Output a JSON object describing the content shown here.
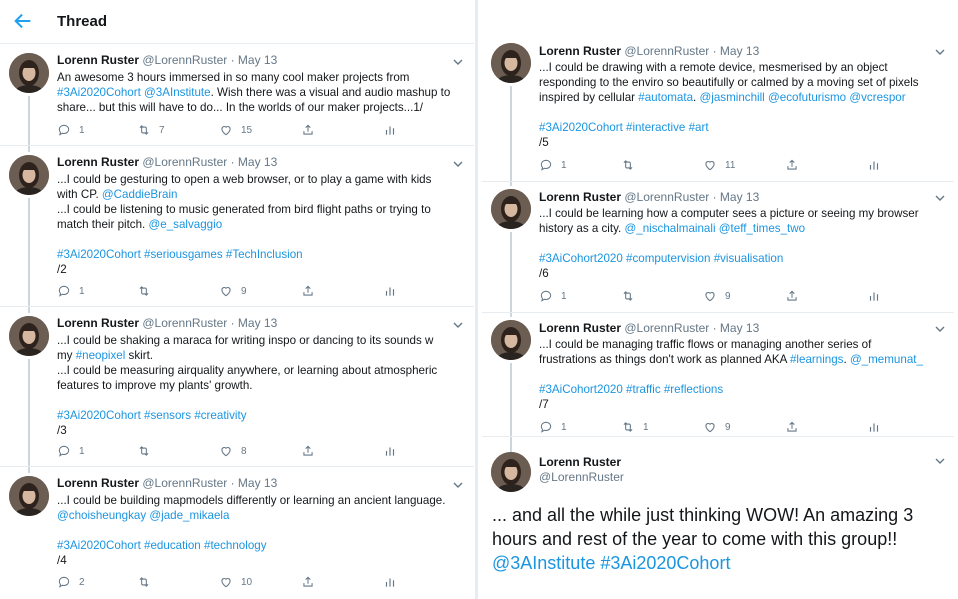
{
  "header": {
    "title": "Thread",
    "back_icon": "arrow-left-icon"
  },
  "left": [
    {
      "name": "Lorenn Ruster",
      "handle": "@LorennRuster",
      "date": "· May 13",
      "lines": [
        [
          {
            "t": "An awesome 3 hours immersed in so many cool maker projects from"
          }
        ],
        [
          {
            "t": "#3Ai2020Cohort",
            "l": true
          },
          {
            "t": " "
          },
          {
            "t": "@3AInstitute",
            "l": true
          },
          {
            "t": ". Wish there was a visual and audio mashup to"
          }
        ],
        [
          {
            "t": "share... but this will have to do... In the worlds of our maker projects...1/"
          }
        ]
      ],
      "reply": "1",
      "retweet": "7",
      "like": "15"
    },
    {
      "name": "Lorenn Ruster",
      "handle": "@LorennRuster",
      "date": "· May 13",
      "lines": [
        [
          {
            "t": "...I could be gesturing to open a web browser, or to play a game with kids"
          }
        ],
        [
          {
            "t": "with CP. "
          },
          {
            "t": "@CaddieBrain",
            "l": true
          }
        ],
        [
          {
            "t": "...I could be listening to music generated from bird flight paths or trying to"
          }
        ],
        [
          {
            "t": "match their pitch. "
          },
          {
            "t": "@e_salvaggio",
            "l": true
          }
        ],
        [
          {
            "t": ""
          }
        ],
        [
          {
            "t": "#3Ai2020Cohort",
            "l": true
          },
          {
            "t": " "
          },
          {
            "t": "#seriousgames",
            "l": true
          },
          {
            "t": " "
          },
          {
            "t": "#TechInclusion",
            "l": true
          }
        ],
        [
          {
            "t": "/2"
          }
        ]
      ],
      "reply": "1",
      "retweet": "",
      "like": "9"
    },
    {
      "name": "Lorenn Ruster",
      "handle": "@LorennRuster",
      "date": "· May 13",
      "lines": [
        [
          {
            "t": "...I could be shaking a maraca for writing inspo or dancing to its sounds w"
          }
        ],
        [
          {
            "t": "my "
          },
          {
            "t": "#neopixel",
            "l": true
          },
          {
            "t": " skirt."
          }
        ],
        [
          {
            "t": "...I could be measuring airquality anywhere, or learning about atmospheric"
          }
        ],
        [
          {
            "t": "features to improve my plants' growth."
          }
        ],
        [
          {
            "t": ""
          }
        ],
        [
          {
            "t": "#3Ai2020Cohort",
            "l": true
          },
          {
            "t": " "
          },
          {
            "t": "#sensors",
            "l": true
          },
          {
            "t": " "
          },
          {
            "t": "#creativity",
            "l": true
          }
        ],
        [
          {
            "t": "/3"
          }
        ]
      ],
      "reply": "1",
      "retweet": "",
      "like": "8"
    },
    {
      "name": "Lorenn Ruster",
      "handle": "@LorennRuster",
      "date": "· May 13",
      "lines": [
        [
          {
            "t": "...I could be building mapmodels differently or learning an ancient language."
          }
        ],
        [
          {
            "t": "@choisheungkay",
            "l": true
          },
          {
            "t": " "
          },
          {
            "t": "@jade_mikaela",
            "l": true
          }
        ],
        [
          {
            "t": ""
          }
        ],
        [
          {
            "t": "#3Ai2020Cohort",
            "l": true
          },
          {
            "t": " "
          },
          {
            "t": "#education",
            "l": true
          },
          {
            "t": " "
          },
          {
            "t": "#technology",
            "l": true
          }
        ],
        [
          {
            "t": "/4"
          }
        ]
      ],
      "reply": "2",
      "retweet": "",
      "like": "10"
    }
  ],
  "right": [
    {
      "name": "Lorenn Ruster",
      "handle": "@LorennRuster",
      "date": "· May 13",
      "lines": [
        [
          {
            "t": "...I could be drawing with a remote device, mesmerised by an object"
          }
        ],
        [
          {
            "t": "responding to the enviro so beautifully or calmed by a moving set of pixels"
          }
        ],
        [
          {
            "t": "inspired by cellular "
          },
          {
            "t": "#automata",
            "l": true
          },
          {
            "t": ". "
          },
          {
            "t": "@jasminchill",
            "l": true
          },
          {
            "t": "  "
          },
          {
            "t": "@ecofuturismo",
            "l": true
          },
          {
            "t": " "
          },
          {
            "t": "@vcrespor",
            "l": true
          }
        ],
        [
          {
            "t": ""
          }
        ],
        [
          {
            "t": "#3Ai2020Cohort",
            "l": true
          },
          {
            "t": "  "
          },
          {
            "t": "#interactive",
            "l": true
          },
          {
            "t": " "
          },
          {
            "t": "#art",
            "l": true
          }
        ],
        [
          {
            "t": "/5"
          }
        ]
      ],
      "reply": "1",
      "retweet": "",
      "like": "11"
    },
    {
      "name": "Lorenn Ruster",
      "handle": "@LorennRuster",
      "date": "· May 13",
      "lines": [
        [
          {
            "t": "...I could be learning how a computer sees a picture or seeing my browser"
          }
        ],
        [
          {
            "t": "history as a city. "
          },
          {
            "t": "@_nischalmainali",
            "l": true
          },
          {
            "t": " "
          },
          {
            "t": "@teff_times_two",
            "l": true
          }
        ],
        [
          {
            "t": ""
          }
        ],
        [
          {
            "t": "#3AiCohort2020",
            "l": true
          },
          {
            "t": " "
          },
          {
            "t": "#computervision",
            "l": true
          },
          {
            "t": " "
          },
          {
            "t": "#visualisation",
            "l": true
          }
        ],
        [
          {
            "t": "/6"
          }
        ]
      ],
      "reply": "1",
      "retweet": "",
      "like": "9"
    },
    {
      "name": "Lorenn Ruster",
      "handle": "@LorennRuster",
      "date": "· May 13",
      "lines": [
        [
          {
            "t": "...I could be managing traffic flows or managing another series of"
          }
        ],
        [
          {
            "t": "frustrations as things don't work as planned AKA "
          },
          {
            "t": "#learnings",
            "l": true
          },
          {
            "t": ". "
          },
          {
            "t": "@_memunat_",
            "l": true
          }
        ],
        [
          {
            "t": ""
          }
        ],
        [
          {
            "t": "#3AiCohort2020",
            "l": true
          },
          {
            "t": " "
          },
          {
            "t": "#traffic",
            "l": true
          },
          {
            "t": " "
          },
          {
            "t": "#reflections",
            "l": true
          }
        ],
        [
          {
            "t": "/7"
          }
        ]
      ],
      "reply": "1",
      "retweet": "1",
      "like": "9"
    }
  ],
  "final": {
    "name": "Lorenn Ruster",
    "handle": "@LorennRuster",
    "lines": [
      [
        {
          "t": "... and all the while just thinking WOW! An amazing 3"
        }
      ],
      [
        {
          "t": "hours and rest of the year to come with this group!!"
        }
      ],
      [
        {
          "t": "@3AInstitute",
          "l": true
        },
        {
          "t": " "
        },
        {
          "t": "#3Ai2020Cohort",
          "l": true
        }
      ]
    ]
  },
  "colors": {
    "link": "#1b95e0",
    "accent": "#1da1f2",
    "muted": "#657786"
  }
}
